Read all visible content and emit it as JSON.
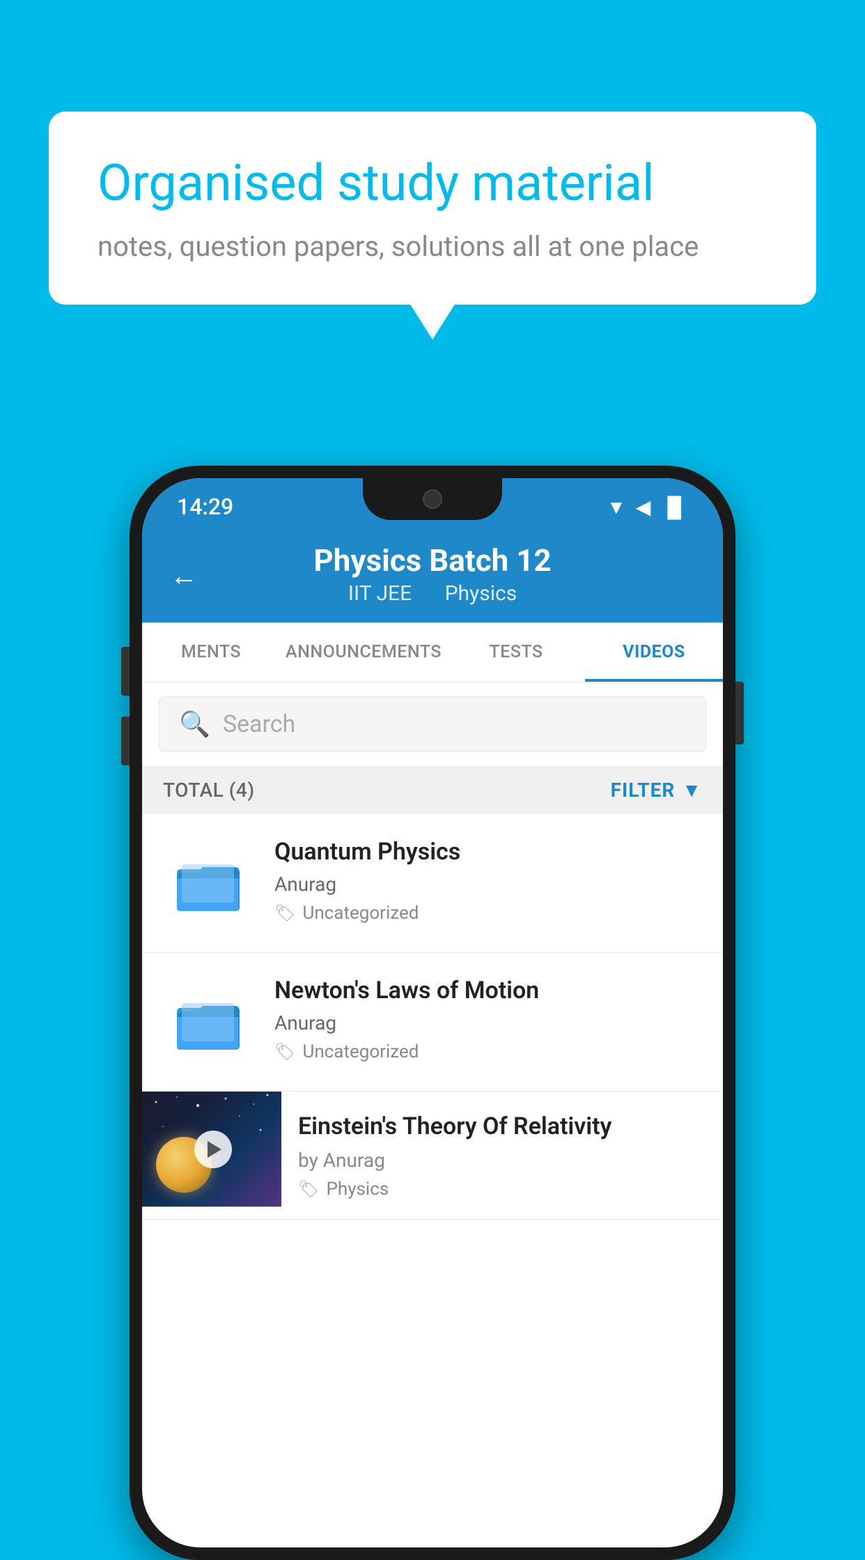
{
  "background": {
    "color": "#00BBEA"
  },
  "speech_bubble": {
    "title": "Organised study material",
    "subtitle": "notes, question papers, solutions all at one place"
  },
  "status_bar": {
    "time": "14:29",
    "wifi": "▼",
    "signal": "▲",
    "battery": "▐"
  },
  "header": {
    "back_label": "←",
    "title": "Physics Batch 12",
    "subtitle_tag1": "IIT JEE",
    "subtitle_tag2": "Physics"
  },
  "tabs": [
    {
      "label": "MENTS",
      "active": false
    },
    {
      "label": "ANNOUNCEMENTS",
      "active": false
    },
    {
      "label": "TESTS",
      "active": false
    },
    {
      "label": "VIDEOS",
      "active": true
    }
  ],
  "search": {
    "placeholder": "Search"
  },
  "filter_bar": {
    "total_label": "TOTAL (4)",
    "filter_label": "FILTER"
  },
  "videos": [
    {
      "type": "folder",
      "title": "Quantum Physics",
      "author": "Anurag",
      "tag": "Uncategorized"
    },
    {
      "type": "folder",
      "title": "Newton's Laws of Motion",
      "author": "Anurag",
      "tag": "Uncategorized"
    },
    {
      "type": "thumbnail",
      "title": "Einstein's Theory Of Relativity",
      "author": "by Anurag",
      "tag": "Physics"
    }
  ]
}
